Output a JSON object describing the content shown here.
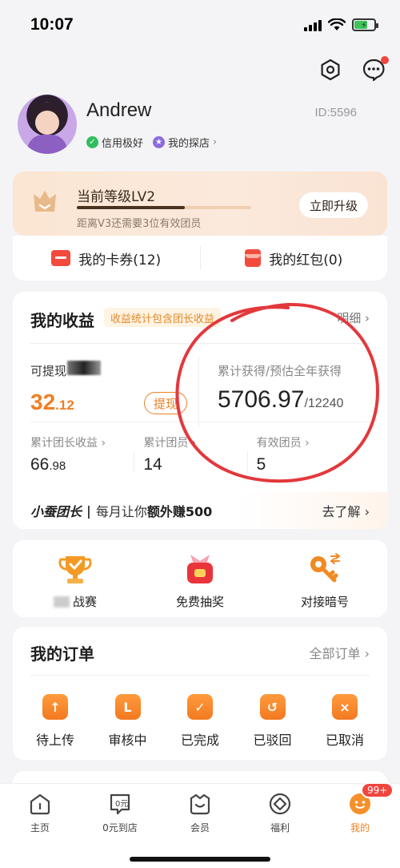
{
  "status_bar": {
    "time": "10:07"
  },
  "profile": {
    "name": "Andrew",
    "id": "ID:5596",
    "badges": [
      "信用极好",
      "我的探店"
    ]
  },
  "level": {
    "title": "当前等级LV2",
    "progress": 0.62,
    "subtitle": "距离V3还需要3位有效团员",
    "upgrade_label": "立即升级"
  },
  "wallet": {
    "coupons": "我的卡券(12)",
    "redpackets": "我的红包(0)"
  },
  "earnings": {
    "title": "我的收益",
    "tag": "收益统计包含团长收益",
    "detail": "明细",
    "withdraw_label": "可提现",
    "withdraw_int": "32",
    "withdraw_dec": ".12",
    "withdraw_button": "提现",
    "total_label": "累计获得/预估全年获得",
    "total_value": "5706.97",
    "total_estimate": "/12240",
    "stats": [
      {
        "label": "累计团长收益",
        "int": "66",
        "dec": ".98"
      },
      {
        "label": "累计团员",
        "int": "14",
        "dec": ""
      },
      {
        "label": "有效团员",
        "int": "5",
        "dec": ""
      }
    ],
    "promo_brand": "小蚕团长",
    "promo_text_prefix": "每月让你",
    "promo_text_bold": "额外赚500",
    "promo_link": "去了解"
  },
  "activities": [
    {
      "label": "战赛",
      "icon": "trophy-icon"
    },
    {
      "label": "免费抽奖",
      "icon": "gift-bag-icon"
    },
    {
      "label": "对接暗号",
      "icon": "key-icon"
    }
  ],
  "orders": {
    "title": "我的订单",
    "all": "全部订单",
    "items": [
      {
        "label": "待上传",
        "glyph": "↑"
      },
      {
        "label": "审核中",
        "glyph": "L"
      },
      {
        "label": "已完成",
        "glyph": "✓"
      },
      {
        "label": "已驳回",
        "glyph": "↺"
      },
      {
        "label": "已取消",
        "glyph": "×"
      }
    ]
  },
  "tabs": [
    {
      "label": "主页",
      "icon": "home-icon"
    },
    {
      "label": "0元到店",
      "icon": "zero-yuan-icon"
    },
    {
      "label": "会员",
      "icon": "member-icon"
    },
    {
      "label": "福利",
      "icon": "welfare-icon"
    },
    {
      "label": "我的",
      "icon": "mine-icon",
      "badge": "99+",
      "active": true
    }
  ],
  "colors": {
    "accent": "#f07f23",
    "red": "#f2453d"
  }
}
